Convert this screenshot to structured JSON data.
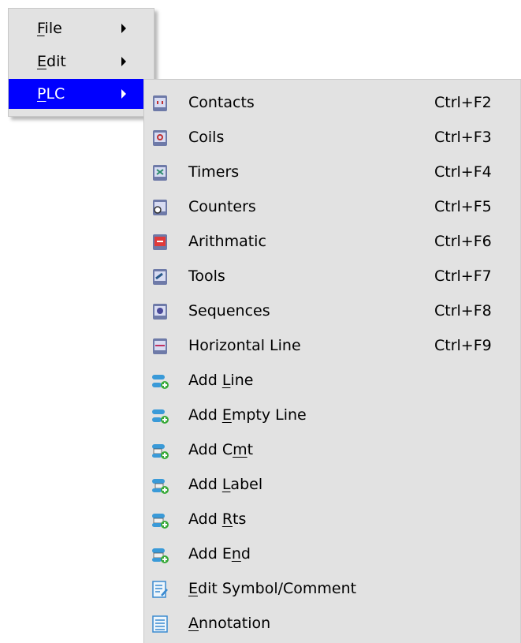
{
  "main_menu": {
    "items": [
      {
        "label": "File",
        "mnemonic": "F",
        "rest": "ile",
        "has_submenu": true,
        "selected": false
      },
      {
        "label": "Edit",
        "mnemonic": "E",
        "rest": "dit",
        "has_submenu": true,
        "selected": false
      },
      {
        "label": "PLC",
        "mnemonic": "P",
        "rest": "LC",
        "has_submenu": true,
        "selected": true
      }
    ]
  },
  "plc_menu": {
    "items": [
      {
        "pre": "Contacts",
        "mn": "",
        "post": "",
        "shortcut": "Ctrl+F2",
        "icon": "contacts-icon"
      },
      {
        "pre": "Coils",
        "mn": "",
        "post": "",
        "shortcut": "Ctrl+F3",
        "icon": "coils-icon"
      },
      {
        "pre": "Timers",
        "mn": "",
        "post": "",
        "shortcut": "Ctrl+F4",
        "icon": "timers-icon"
      },
      {
        "pre": "Counters",
        "mn": "",
        "post": "",
        "shortcut": "Ctrl+F5",
        "icon": "counters-icon"
      },
      {
        "pre": "Arithmatic",
        "mn": "",
        "post": "",
        "shortcut": "Ctrl+F6",
        "icon": "arithmatic-icon"
      },
      {
        "pre": "Tools",
        "mn": "",
        "post": "",
        "shortcut": "Ctrl+F7",
        "icon": "tools-icon"
      },
      {
        "pre": "Sequences",
        "mn": "",
        "post": "",
        "shortcut": "Ctrl+F8",
        "icon": "sequences-icon"
      },
      {
        "pre": "Horizontal Line",
        "mn": "",
        "post": "",
        "shortcut": "Ctrl+F9",
        "icon": "horizontal-line-icon"
      },
      {
        "pre": "Add ",
        "mn": "L",
        "post": "ine",
        "shortcut": "",
        "icon": "add-line-icon"
      },
      {
        "pre": "Add ",
        "mn": "E",
        "post": "mpty Line",
        "shortcut": "",
        "icon": "add-empty-line-icon"
      },
      {
        "pre": "Add C",
        "mn": "m",
        "post": "t",
        "shortcut": "",
        "icon": "add-comment-icon"
      },
      {
        "pre": "Add ",
        "mn": "L",
        "post": "abel",
        "shortcut": "",
        "icon": "add-label-icon"
      },
      {
        "pre": "Add ",
        "mn": "R",
        "post": "ts",
        "shortcut": "",
        "icon": "add-rts-icon"
      },
      {
        "pre": "Add E",
        "mn": "n",
        "post": "d",
        "shortcut": "",
        "icon": "add-end-icon"
      },
      {
        "pre": "",
        "mn": "E",
        "post": "dit Symbol/Comment",
        "shortcut": "",
        "icon": "edit-symbol-comment-icon"
      },
      {
        "pre": "",
        "mn": "A",
        "post": "nnotation",
        "shortcut": "",
        "icon": "annotation-icon"
      }
    ]
  },
  "colors": {
    "menu_bg": "#e2e2e2",
    "selected_bg": "#0000ff",
    "selected_text": "#ffffff"
  }
}
